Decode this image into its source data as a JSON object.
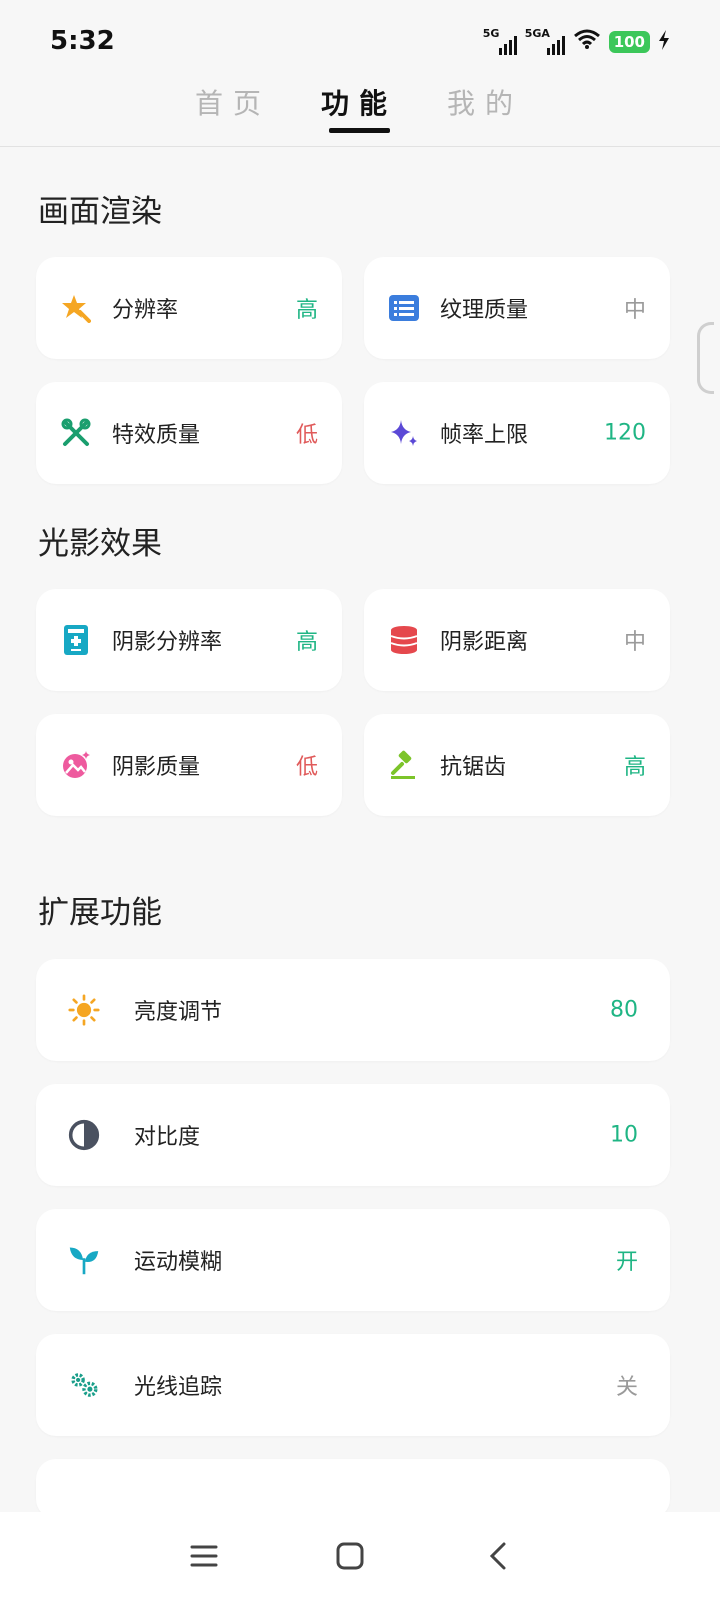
{
  "status_bar": {
    "time": "5:32",
    "sim1": "5G",
    "sim2": "5GA",
    "battery": "100"
  },
  "tabs": [
    {
      "label": "首页",
      "active": false
    },
    {
      "label": "功能",
      "active": true
    },
    {
      "label": "我的",
      "active": false
    }
  ],
  "sections": {
    "render": {
      "title": "画面渲染",
      "items": [
        {
          "label": "分辨率",
          "value": "高",
          "value_color": "#1fb584",
          "icon": "magic-star-icon"
        },
        {
          "label": "纹理质量",
          "value": "中",
          "value_color": "#9a9a9a",
          "icon": "list-icon"
        },
        {
          "label": "特效质量",
          "value": "低",
          "value_color": "#e05a5a",
          "icon": "tools-icon"
        },
        {
          "label": "帧率上限",
          "value": "120",
          "value_color": "#1fb584",
          "icon": "sparkle-icon"
        }
      ]
    },
    "lighting": {
      "title": "光影效果",
      "items": [
        {
          "label": "阴影分辨率",
          "value": "高",
          "value_color": "#1fb584",
          "icon": "calculator-icon"
        },
        {
          "label": "阴影距离",
          "value": "中",
          "value_color": "#9a9a9a",
          "icon": "database-icon"
        },
        {
          "label": "阴影质量",
          "value": "低",
          "value_color": "#e05a5a",
          "icon": "image-sparkle-icon"
        },
        {
          "label": "抗锯齿",
          "value": "高",
          "value_color": "#1fb584",
          "icon": "gavel-icon"
        }
      ]
    },
    "extended": {
      "title": "扩展功能",
      "items": [
        {
          "label": "亮度调节",
          "value": "80",
          "value_color": "#1fb584",
          "icon": "sun-icon"
        },
        {
          "label": "对比度",
          "value": "10",
          "value_color": "#1fb584",
          "icon": "contrast-icon"
        },
        {
          "label": "运动模糊",
          "value": "开",
          "value_color": "#1fb584",
          "icon": "sprout-icon"
        },
        {
          "label": "光线追踪",
          "value": "关",
          "value_color": "#9a9a9a",
          "icon": "gears-icon"
        }
      ]
    }
  },
  "nav": {
    "menu": "menu-icon",
    "home": "home-icon",
    "back": "back-icon"
  }
}
